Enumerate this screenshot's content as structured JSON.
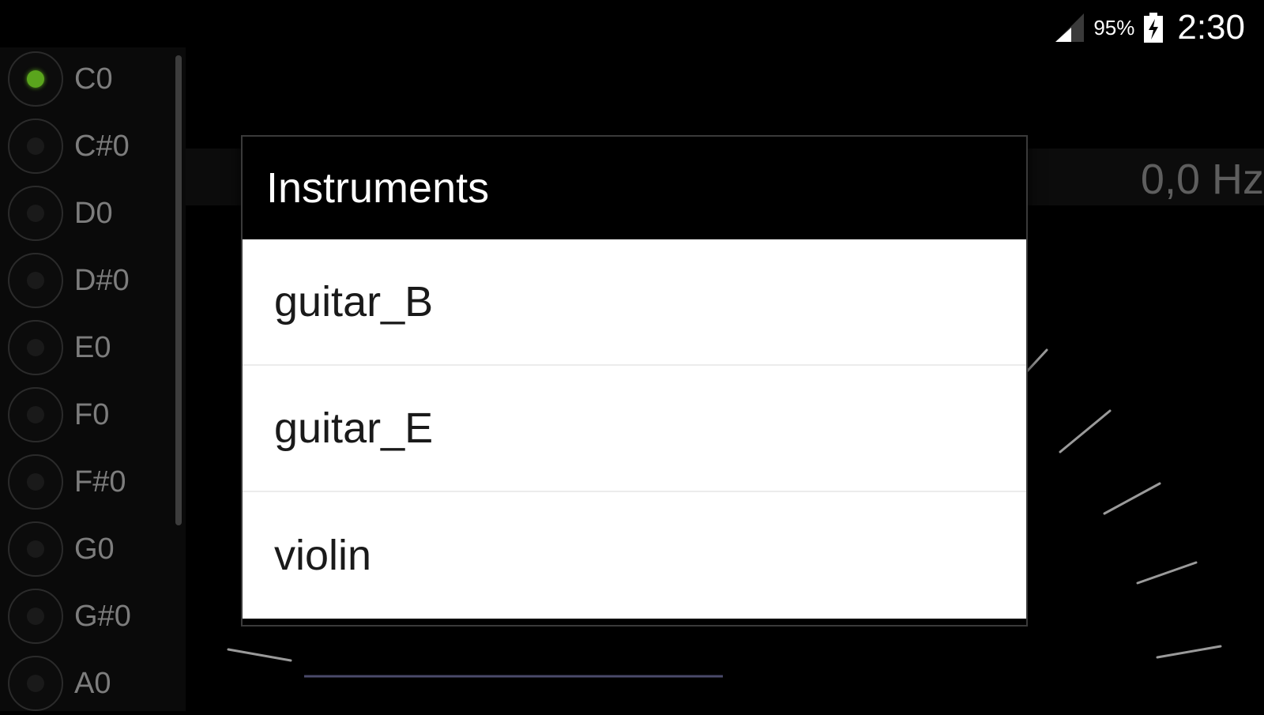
{
  "status_bar": {
    "battery_percent": "95%",
    "time": "2:30",
    "icons": [
      "signal-icon",
      "battery-charging-icon"
    ]
  },
  "notes": [
    {
      "label": "C0",
      "active": true
    },
    {
      "label": "C#0",
      "active": false
    },
    {
      "label": "D0",
      "active": false
    },
    {
      "label": "D#0",
      "active": false
    },
    {
      "label": "E0",
      "active": false
    },
    {
      "label": "F0",
      "active": false
    },
    {
      "label": "F#0",
      "active": false
    },
    {
      "label": "G0",
      "active": false
    },
    {
      "label": "G#0",
      "active": false
    },
    {
      "label": "A0",
      "active": false
    }
  ],
  "tuner": {
    "frequency": "0,0 Hz"
  },
  "dialog": {
    "title": "Instruments",
    "items": [
      "guitar_B",
      "guitar_E",
      "violin"
    ]
  },
  "colors": {
    "active_led": "#5aa51d",
    "background": "#000000",
    "dialog_list_bg": "#ffffff"
  }
}
